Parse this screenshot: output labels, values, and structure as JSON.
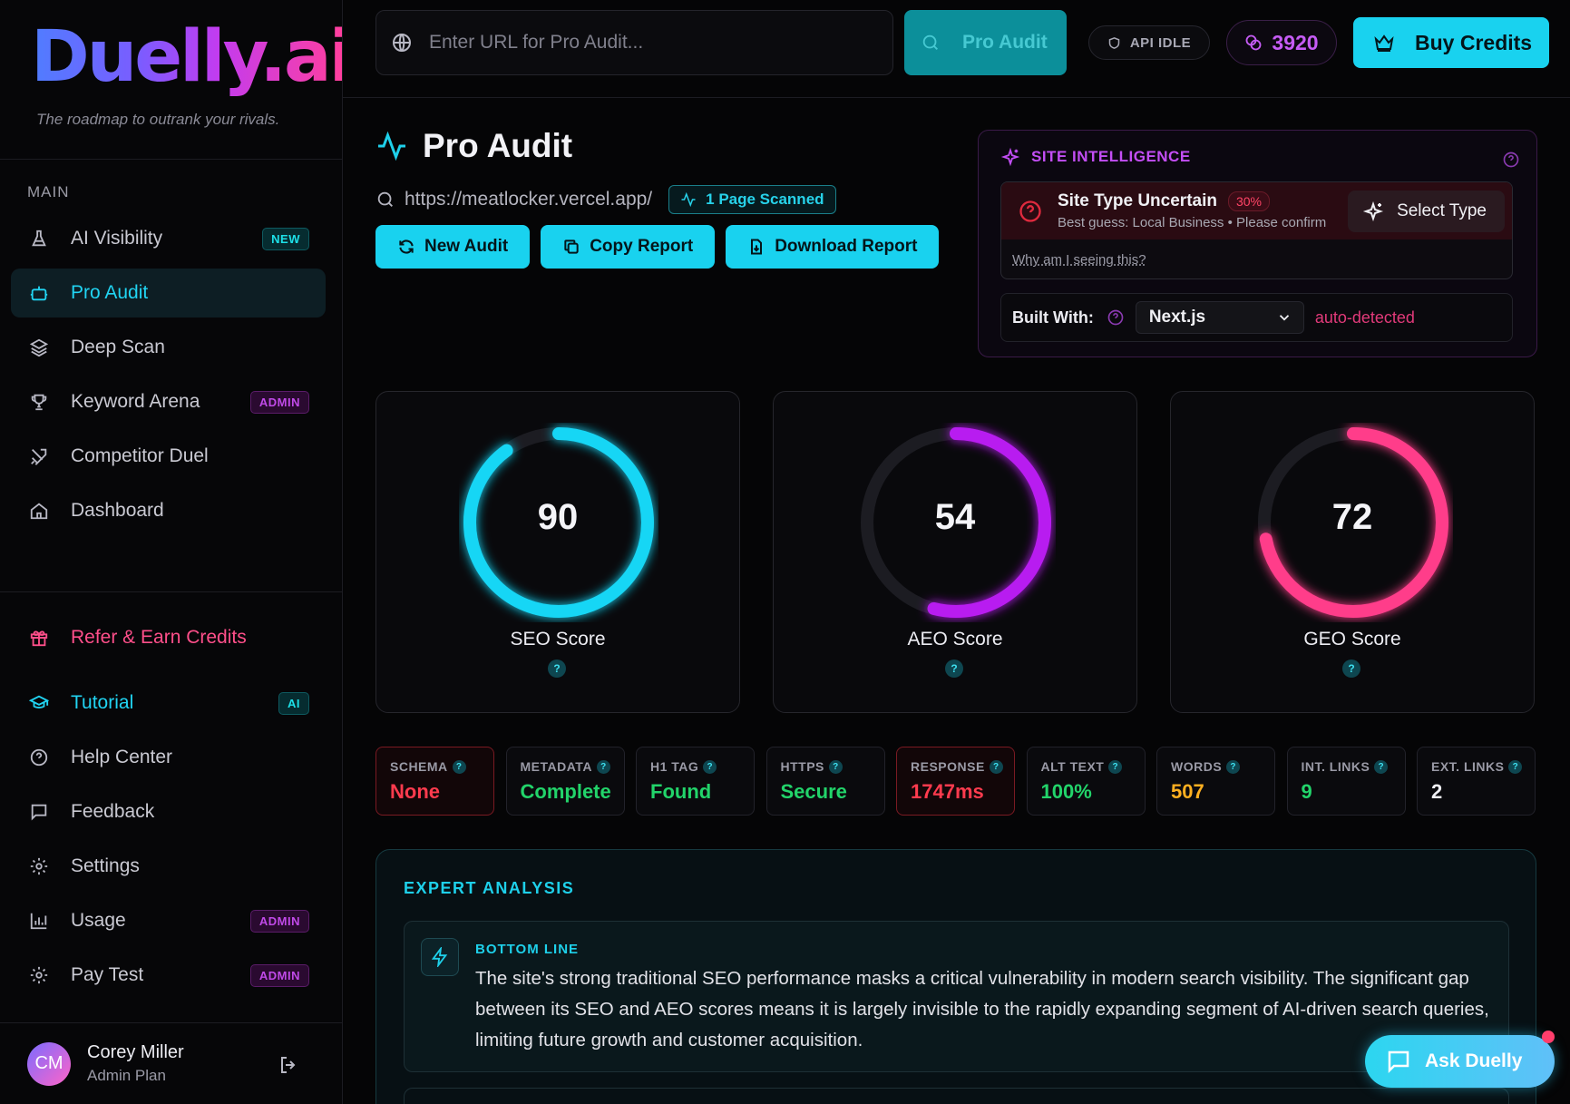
{
  "brand": {
    "logo": "Duelly.ai",
    "tagline": "The roadmap to outrank your rivals."
  },
  "sidebar": {
    "section": "MAIN",
    "items": [
      {
        "label": "AI Visibility",
        "badge": "NEW",
        "icon": "flask-icon"
      },
      {
        "label": "Pro Audit",
        "badge": "",
        "icon": "robot-icon",
        "active": true
      },
      {
        "label": "Deep Scan",
        "badge": "",
        "icon": "layers-icon"
      },
      {
        "label": "Keyword Arena",
        "badge": "ADMIN",
        "icon": "trophy-icon"
      },
      {
        "label": "Competitor Duel",
        "badge": "",
        "icon": "swords-icon"
      },
      {
        "label": "Dashboard",
        "badge": "",
        "icon": "home-icon"
      }
    ],
    "refer": "Refer & Earn Credits",
    "bottom_items": [
      {
        "label": "Tutorial",
        "badge": "AI",
        "icon": "graduation-cap-icon"
      },
      {
        "label": "Help Center",
        "badge": "",
        "icon": "help-circle-icon"
      },
      {
        "label": "Feedback",
        "badge": "",
        "icon": "message-square-icon"
      },
      {
        "label": "Settings",
        "badge": "",
        "icon": "gear-icon"
      },
      {
        "label": "Usage",
        "badge": "ADMIN",
        "icon": "bar-chart-icon"
      },
      {
        "label": "Pay Test",
        "badge": "ADMIN",
        "icon": "gear-icon"
      }
    ],
    "user": {
      "initials": "CM",
      "name": "Corey Miller",
      "plan": "Admin Plan"
    }
  },
  "topbar": {
    "url_placeholder": "Enter URL for Pro Audit...",
    "audit_button": "Pro Audit",
    "api_status": "API IDLE",
    "credits": "3920",
    "buy_button": "Buy Credits"
  },
  "page": {
    "title": "Pro Audit",
    "url": "https://meatlocker.vercel.app/",
    "scanned": "1 Page Scanned",
    "actions": {
      "new_audit": "New Audit",
      "copy_report": "Copy Report",
      "download_report": "Download Report"
    }
  },
  "site_intelligence": {
    "title": "SITE INTELLIGENCE",
    "uncertain_title": "Site Type Uncertain",
    "confidence": "30%",
    "best_guess": "Best guess: Local Business • Please confirm",
    "select_type": "Select Type",
    "why": "Why am I seeing this?",
    "built_with_label": "Built With:",
    "framework": "Next.js",
    "detected": "auto-detected"
  },
  "scores": [
    {
      "label": "SEO Score",
      "value": 90,
      "color": "#16d6f5",
      "start": 0.985
    },
    {
      "label": "AEO Score",
      "value": 54,
      "color": "#b81df0",
      "start": 0.0
    },
    {
      "label": "GEO Score",
      "value": 72,
      "color": "#ff3d8a",
      "start": 0.0
    }
  ],
  "metrics": [
    {
      "label": "SCHEMA",
      "value": "None",
      "color": "#ff3b4e",
      "bad": true
    },
    {
      "label": "METADATA",
      "value": "Complete",
      "color": "#22d46a",
      "bad": false
    },
    {
      "label": "H1 TAG",
      "value": "Found",
      "color": "#22d46a",
      "bad": false
    },
    {
      "label": "HTTPS",
      "value": "Secure",
      "color": "#22d46a",
      "bad": false
    },
    {
      "label": "RESPONSE",
      "value": "1747ms",
      "color": "#ff3b4e",
      "bad": true
    },
    {
      "label": "ALT TEXT",
      "value": "100%",
      "color": "#22d46a",
      "bad": false
    },
    {
      "label": "WORDS",
      "value": "507",
      "color": "#ffb020",
      "bad": false
    },
    {
      "label": "INT. LINKS",
      "value": "9",
      "color": "#22d46a",
      "bad": false
    },
    {
      "label": "EXT. LINKS",
      "value": "2",
      "color": "#f0f0f4",
      "bad": false
    }
  ],
  "expert": {
    "title": "EXPERT ANALYSIS",
    "bottom_line_title": "BOTTOM LINE",
    "bottom_line_text": "The site's strong traditional SEO performance masks a critical vulnerability in modern search visibility. The significant gap between its SEO and AEO scores means it is largely invisible to the rapidly expanding segment of AI-driven search queries, limiting future growth and customer acquisition."
  },
  "ask_button": "Ask Duelly",
  "colors": {
    "accent": "#19d2ef",
    "purple": "#c34ef5",
    "pink": "#ff3d8a"
  }
}
